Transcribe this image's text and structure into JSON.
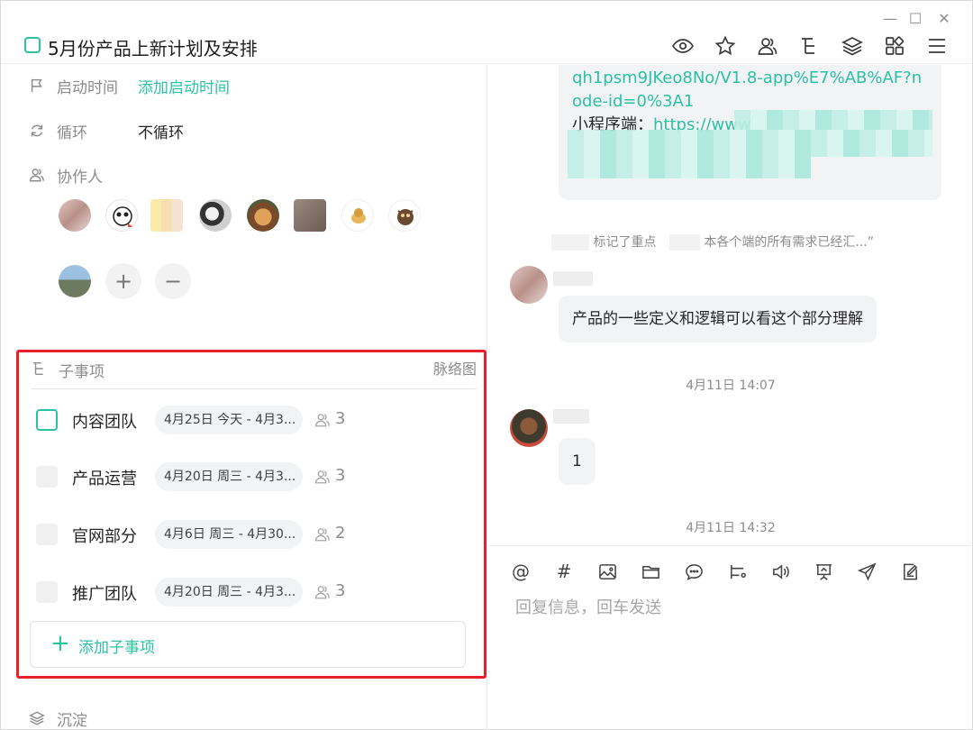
{
  "window": {
    "minimize": "—",
    "maximize": "☐",
    "close": "✕"
  },
  "header": {
    "title": "5月份产品上新计划及安排",
    "icons": [
      "eye-icon",
      "star-icon",
      "members-icon",
      "subtask-tree-icon",
      "layers-icon",
      "apps-icon",
      "menu-icon"
    ]
  },
  "fields": {
    "start_time": {
      "label": "启动时间",
      "value": "添加启动时间"
    },
    "repeat": {
      "label": "循环",
      "value": "不循环"
    },
    "collaborators": {
      "label": "协作人",
      "count": 9,
      "add": "+",
      "remove": "−"
    }
  },
  "subtasks": {
    "title": "子事项",
    "mindmap_link": "脉络图",
    "items": [
      {
        "name": "内容团队",
        "date": "4月25日 今天 - 4月3...",
        "count": "3",
        "active": true
      },
      {
        "name": "产品运营",
        "date": "4月20日 周三 - 4月3...",
        "count": "3",
        "active": false
      },
      {
        "name": "官网部分",
        "date": "4月6日 周三 - 4月30...",
        "count": "2",
        "active": false
      },
      {
        "name": "推广团队",
        "date": "4月20日 周三 - 4月3...",
        "count": "3",
        "active": false
      }
    ],
    "add_label": "添加子事项",
    "add_icon": "+"
  },
  "sediment": {
    "label": "沉淀"
  },
  "chat": {
    "top_bubble": {
      "link": "qh1psm9JKeo8No/V1.8-app%E7%AB%AF?node-id=0%3A1",
      "line_label": "小程序端：",
      "line_link": "https://www"
    },
    "system_note": {
      "marked": "标记了重点",
      "quote": "本各个端的所有需求已经汇...”"
    },
    "messages": [
      {
        "text": "产品的一些定义和逻辑可以看这个部分理解"
      },
      {
        "text": "1"
      }
    ],
    "timestamps": [
      "4月11日 14:07",
      "4月11日 14:32"
    ]
  },
  "composer": {
    "tools": [
      "at-icon",
      "hashtag-icon",
      "image-icon",
      "folder-icon",
      "chat-bubble-icon",
      "subtask-icon",
      "voice-icon",
      "presentation-icon",
      "send-plane-icon",
      "note-edit-icon"
    ],
    "at_symbol": "@",
    "hash_symbol": "#",
    "placeholder": "回复信息，回车发送"
  },
  "colors": {
    "accent": "#2bc1a5",
    "highlight_border": "#e8202a"
  }
}
